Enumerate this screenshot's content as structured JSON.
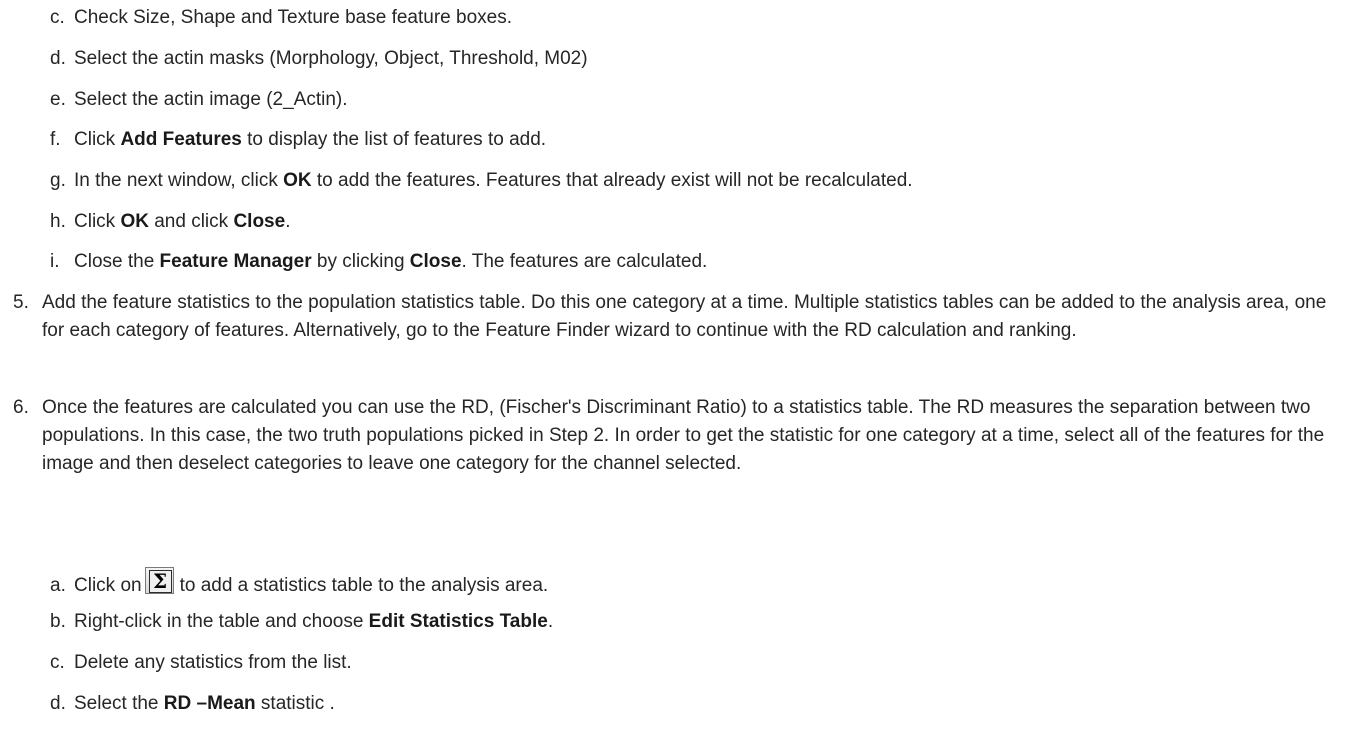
{
  "steps_4": [
    {
      "label": "c.",
      "text": "Check Size, Shape and Texture base feature boxes."
    },
    {
      "label": "d.",
      "text": "Select the actin masks (Morphology, Object, Threshold, M02)"
    },
    {
      "label": "e.",
      "text": "Select the actin image (2_Actin)."
    },
    {
      "label": "f.",
      "pre": "Click ",
      "bold": "Add Features",
      "post": " to display the list of features to add."
    },
    {
      "label": "g.",
      "pre": "In the next window, click ",
      "bold": "OK",
      "post": " to add the features. Features that already exist will not be recalculated."
    },
    {
      "label": "h.",
      "pre": "Click ",
      "bold": "OK",
      "mid": " and click ",
      "bold2": "Close",
      "post": "."
    },
    {
      "label": "i.",
      "pre": "Close the ",
      "bold": "Feature Manager",
      "mid": " by clicking ",
      "bold2": "Close",
      "post": ". The features are calculated."
    }
  ],
  "step_5": {
    "label": "5.",
    "text": "Add the feature statistics to the population statistics table. Do this one category at a time. Multiple statistics tables can be added to the analysis area, one for each category of features. Alternatively, go to the Feature Finder wizard to continue with the RD calculation and ranking."
  },
  "step_6": {
    "label": "6.",
    "text": "Once the features are calculated you can use the RD, (Fischer's Discriminant Ratio) to a statistics table. The RD measures the separation between two populations. In this case, the two truth populations picked in Step 2. In order to get the statistic for one category at a time, select all of the features for the image and then deselect categories to leave one category for the channel selected."
  },
  "steps_6": {
    "a": {
      "label": "a.",
      "pre": "Click on",
      "icon": "sigma-icon",
      "icon_glyph": "Σ",
      "post": "to add a statistics table to the analysis area."
    },
    "b": {
      "label": "b.",
      "pre": "Right-click in the table and choose ",
      "bold": "Edit Statistics Table",
      "post": "."
    },
    "c": {
      "label": "c.",
      "text": "Delete any statistics from the list."
    },
    "d": {
      "label": "d.",
      "pre": "Select the ",
      "bold": "RD –Mean",
      "post": " statistic ."
    }
  }
}
